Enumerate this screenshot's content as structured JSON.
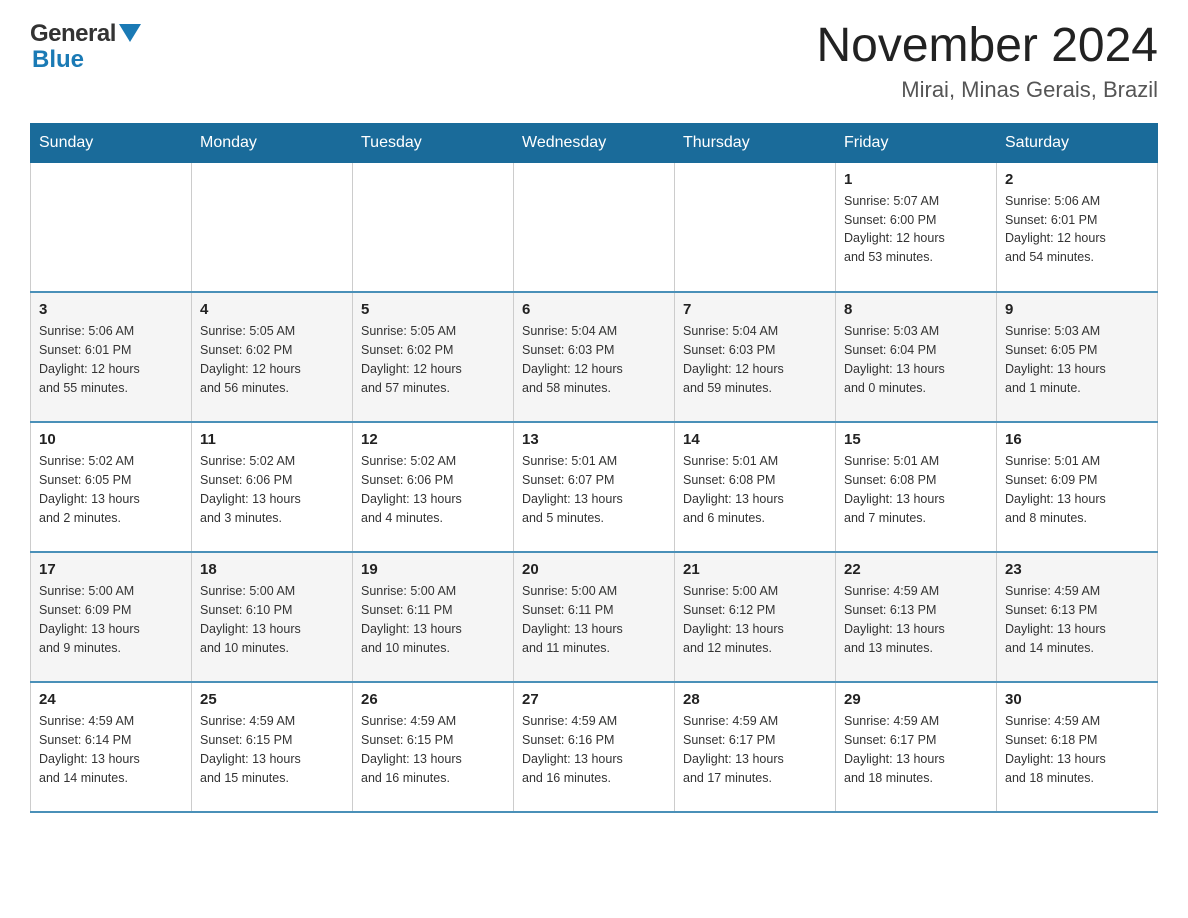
{
  "header": {
    "logo": {
      "general": "General",
      "blue": "Blue"
    },
    "title": "November 2024",
    "subtitle": "Mirai, Minas Gerais, Brazil"
  },
  "weekdays": [
    "Sunday",
    "Monday",
    "Tuesday",
    "Wednesday",
    "Thursday",
    "Friday",
    "Saturday"
  ],
  "weeks": [
    [
      {
        "day": "",
        "info": ""
      },
      {
        "day": "",
        "info": ""
      },
      {
        "day": "",
        "info": ""
      },
      {
        "day": "",
        "info": ""
      },
      {
        "day": "",
        "info": ""
      },
      {
        "day": "1",
        "info": "Sunrise: 5:07 AM\nSunset: 6:00 PM\nDaylight: 12 hours\nand 53 minutes."
      },
      {
        "day": "2",
        "info": "Sunrise: 5:06 AM\nSunset: 6:01 PM\nDaylight: 12 hours\nand 54 minutes."
      }
    ],
    [
      {
        "day": "3",
        "info": "Sunrise: 5:06 AM\nSunset: 6:01 PM\nDaylight: 12 hours\nand 55 minutes."
      },
      {
        "day": "4",
        "info": "Sunrise: 5:05 AM\nSunset: 6:02 PM\nDaylight: 12 hours\nand 56 minutes."
      },
      {
        "day": "5",
        "info": "Sunrise: 5:05 AM\nSunset: 6:02 PM\nDaylight: 12 hours\nand 57 minutes."
      },
      {
        "day": "6",
        "info": "Sunrise: 5:04 AM\nSunset: 6:03 PM\nDaylight: 12 hours\nand 58 minutes."
      },
      {
        "day": "7",
        "info": "Sunrise: 5:04 AM\nSunset: 6:03 PM\nDaylight: 12 hours\nand 59 minutes."
      },
      {
        "day": "8",
        "info": "Sunrise: 5:03 AM\nSunset: 6:04 PM\nDaylight: 13 hours\nand 0 minutes."
      },
      {
        "day": "9",
        "info": "Sunrise: 5:03 AM\nSunset: 6:05 PM\nDaylight: 13 hours\nand 1 minute."
      }
    ],
    [
      {
        "day": "10",
        "info": "Sunrise: 5:02 AM\nSunset: 6:05 PM\nDaylight: 13 hours\nand 2 minutes."
      },
      {
        "day": "11",
        "info": "Sunrise: 5:02 AM\nSunset: 6:06 PM\nDaylight: 13 hours\nand 3 minutes."
      },
      {
        "day": "12",
        "info": "Sunrise: 5:02 AM\nSunset: 6:06 PM\nDaylight: 13 hours\nand 4 minutes."
      },
      {
        "day": "13",
        "info": "Sunrise: 5:01 AM\nSunset: 6:07 PM\nDaylight: 13 hours\nand 5 minutes."
      },
      {
        "day": "14",
        "info": "Sunrise: 5:01 AM\nSunset: 6:08 PM\nDaylight: 13 hours\nand 6 minutes."
      },
      {
        "day": "15",
        "info": "Sunrise: 5:01 AM\nSunset: 6:08 PM\nDaylight: 13 hours\nand 7 minutes."
      },
      {
        "day": "16",
        "info": "Sunrise: 5:01 AM\nSunset: 6:09 PM\nDaylight: 13 hours\nand 8 minutes."
      }
    ],
    [
      {
        "day": "17",
        "info": "Sunrise: 5:00 AM\nSunset: 6:09 PM\nDaylight: 13 hours\nand 9 minutes."
      },
      {
        "day": "18",
        "info": "Sunrise: 5:00 AM\nSunset: 6:10 PM\nDaylight: 13 hours\nand 10 minutes."
      },
      {
        "day": "19",
        "info": "Sunrise: 5:00 AM\nSunset: 6:11 PM\nDaylight: 13 hours\nand 10 minutes."
      },
      {
        "day": "20",
        "info": "Sunrise: 5:00 AM\nSunset: 6:11 PM\nDaylight: 13 hours\nand 11 minutes."
      },
      {
        "day": "21",
        "info": "Sunrise: 5:00 AM\nSunset: 6:12 PM\nDaylight: 13 hours\nand 12 minutes."
      },
      {
        "day": "22",
        "info": "Sunrise: 4:59 AM\nSunset: 6:13 PM\nDaylight: 13 hours\nand 13 minutes."
      },
      {
        "day": "23",
        "info": "Sunrise: 4:59 AM\nSunset: 6:13 PM\nDaylight: 13 hours\nand 14 minutes."
      }
    ],
    [
      {
        "day": "24",
        "info": "Sunrise: 4:59 AM\nSunset: 6:14 PM\nDaylight: 13 hours\nand 14 minutes."
      },
      {
        "day": "25",
        "info": "Sunrise: 4:59 AM\nSunset: 6:15 PM\nDaylight: 13 hours\nand 15 minutes."
      },
      {
        "day": "26",
        "info": "Sunrise: 4:59 AM\nSunset: 6:15 PM\nDaylight: 13 hours\nand 16 minutes."
      },
      {
        "day": "27",
        "info": "Sunrise: 4:59 AM\nSunset: 6:16 PM\nDaylight: 13 hours\nand 16 minutes."
      },
      {
        "day": "28",
        "info": "Sunrise: 4:59 AM\nSunset: 6:17 PM\nDaylight: 13 hours\nand 17 minutes."
      },
      {
        "day": "29",
        "info": "Sunrise: 4:59 AM\nSunset: 6:17 PM\nDaylight: 13 hours\nand 18 minutes."
      },
      {
        "day": "30",
        "info": "Sunrise: 4:59 AM\nSunset: 6:18 PM\nDaylight: 13 hours\nand 18 minutes."
      }
    ]
  ]
}
